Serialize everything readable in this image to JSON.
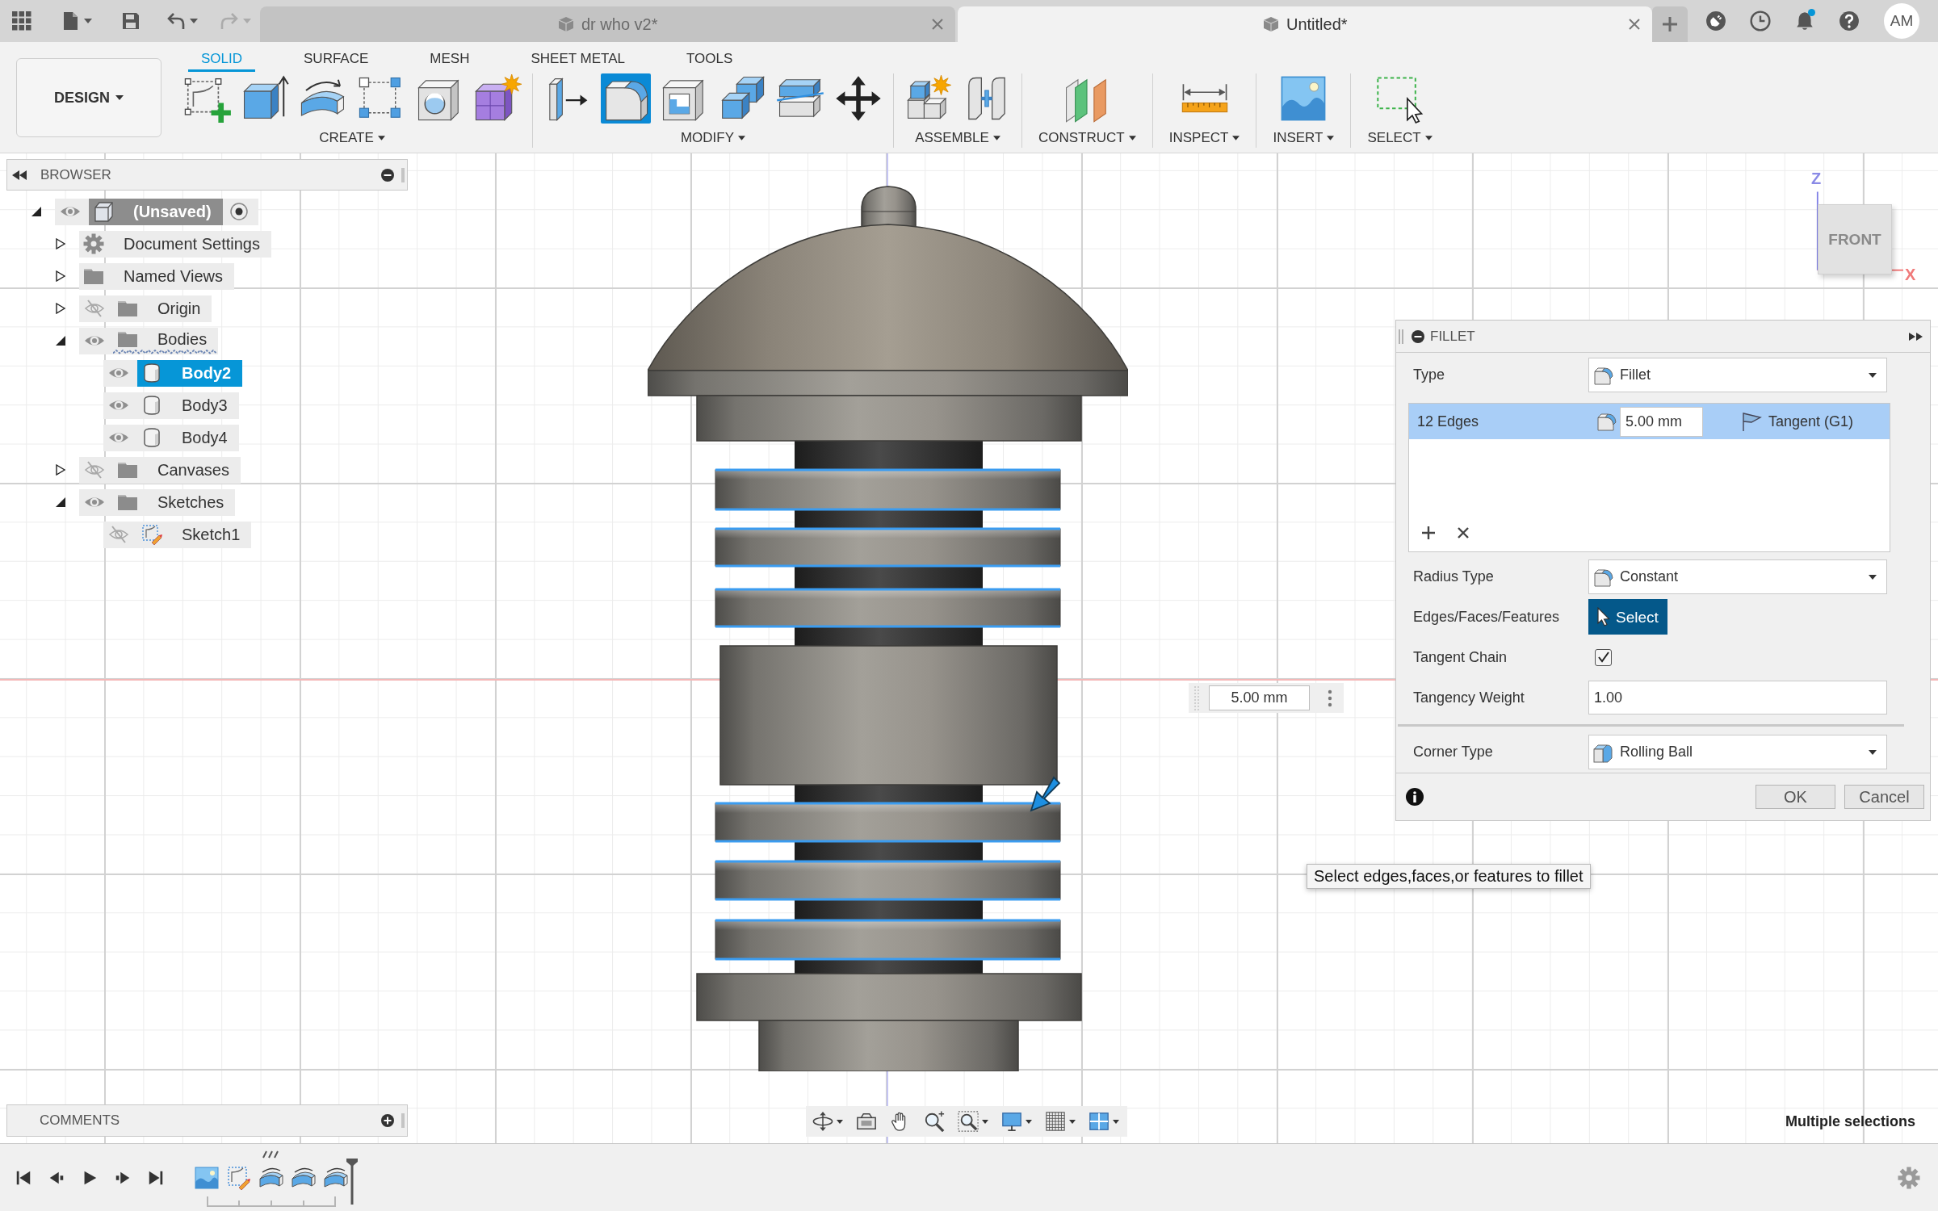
{
  "title_bar": {
    "quick_access": [
      {
        "kind": "apps",
        "disabled": false
      },
      {
        "kind": "file",
        "disabled": false
      },
      {
        "kind": "save",
        "disabled": false
      },
      {
        "kind": "undo",
        "disabled": false
      },
      {
        "kind": "redo",
        "disabled": true
      }
    ],
    "tabs": [
      {
        "title": "dr who v2*",
        "selected": false
      },
      {
        "title": "Untitled*",
        "selected": true
      }
    ],
    "notifications_unread": true,
    "avatar": "AM"
  },
  "toolbar": {
    "workspace": "DESIGN",
    "tabs": [
      {
        "label": "SOLID",
        "selected": true
      },
      {
        "label": "SURFACE",
        "selected": false
      },
      {
        "label": "MESH",
        "selected": false
      },
      {
        "label": "SHEET METAL",
        "selected": false
      },
      {
        "label": "TOOLS",
        "selected": false
      }
    ],
    "groups": [
      {
        "label": "CREATE",
        "tools": [
          {
            "kind": "sketch",
            "selected": false
          },
          {
            "kind": "extrude",
            "selected": false
          },
          {
            "kind": "revolve",
            "selected": false
          },
          {
            "kind": "pattern",
            "selected": false
          },
          {
            "kind": "hole",
            "selected": false
          },
          {
            "kind": "form",
            "selected": false
          }
        ]
      },
      {
        "label": "MODIFY",
        "tools": [
          {
            "kind": "press_pull",
            "selected": false
          },
          {
            "kind": "fillet",
            "selected": true
          },
          {
            "kind": "shell",
            "selected": false
          },
          {
            "kind": "combine",
            "selected": false
          },
          {
            "kind": "split",
            "selected": false
          },
          {
            "kind": "move",
            "selected": false
          }
        ]
      },
      {
        "label": "ASSEMBLE",
        "tools": [
          {
            "kind": "component",
            "selected": false
          },
          {
            "kind": "joint",
            "selected": false
          }
        ]
      },
      {
        "label": "CONSTRUCT",
        "tools": [
          {
            "kind": "plane",
            "selected": false
          }
        ]
      },
      {
        "label": "INSPECT",
        "tools": [
          {
            "kind": "measure",
            "selected": false
          }
        ]
      },
      {
        "label": "INSERT",
        "tools": [
          {
            "kind": "image",
            "selected": false
          }
        ]
      },
      {
        "label": "SELECT",
        "tools": [
          {
            "kind": "window_select",
            "selected": false
          }
        ]
      }
    ]
  },
  "browser": {
    "title": "BROWSER",
    "tree": [
      {
        "label": "(Unsaved)",
        "kind": "component",
        "visible": true,
        "expanded": true,
        "active": true,
        "selected": false,
        "marked": false,
        "children": [
          {
            "label": "Document Settings",
            "kind": "settings",
            "expanded": false,
            "selected": false,
            "marked": false
          },
          {
            "label": "Named Views",
            "kind": "folder",
            "expanded": false,
            "selected": false,
            "marked": false
          },
          {
            "label": "Origin",
            "kind": "folder",
            "visible": false,
            "expanded": false,
            "selected": false,
            "marked": false
          },
          {
            "label": "Bodies",
            "kind": "folder",
            "visible": true,
            "expanded": true,
            "selected": false,
            "marked": true,
            "children": [
              {
                "label": "Body2",
                "kind": "body",
                "visible": true,
                "selected": true,
                "marked": false
              },
              {
                "label": "Body3",
                "kind": "body",
                "visible": true,
                "selected": false,
                "marked": false
              },
              {
                "label": "Body4",
                "kind": "body",
                "visible": true,
                "selected": false,
                "marked": false
              }
            ]
          },
          {
            "label": "Canvases",
            "kind": "folder",
            "visible": false,
            "expanded": false,
            "selected": false,
            "marked": false
          },
          {
            "label": "Sketches",
            "kind": "folder",
            "visible": true,
            "expanded": true,
            "selected": false,
            "marked": false,
            "children": [
              {
                "label": "Sketch1",
                "kind": "sketch",
                "visible": false,
                "selected": false,
                "marked": false
              }
            ]
          }
        ]
      }
    ]
  },
  "viewport": {
    "view_cube": {
      "face": "FRONT",
      "axis_vertical": "Z",
      "axis_horizontal": "X"
    },
    "dimension_input": {
      "value": "5.00 mm"
    },
    "tooltip": "Select edges,faces,or features to fillet",
    "status": "Multiple selections"
  },
  "fillet_panel": {
    "title": "FILLET",
    "type": {
      "label": "Type",
      "value": "Fillet"
    },
    "edge_sets": [
      {
        "label": "12 Edges",
        "radius": "5.00 mm",
        "continuity": "Tangent (G1)",
        "selected": true
      }
    ],
    "radius_type": {
      "label": "Radius Type",
      "value": "Constant"
    },
    "selection": {
      "label": "Edges/Faces/Features",
      "button": "Select",
      "active": true
    },
    "tangent_chain": {
      "label": "Tangent Chain",
      "checked": true
    },
    "tangency_weight": {
      "label": "Tangency Weight",
      "value": "1.00"
    },
    "corner_type": {
      "label": "Corner Type",
      "value": "Rolling Ball"
    },
    "buttons": [
      "OK",
      "Cancel"
    ]
  },
  "comments": {
    "title": "COMMENTS"
  },
  "timeline": {
    "features": [
      {
        "kind": "canvas",
        "marked": false
      },
      {
        "kind": "sketch",
        "marked": false
      },
      {
        "kind": "revolve",
        "marked": true
      },
      {
        "kind": "revolve",
        "marked": false
      },
      {
        "kind": "revolve",
        "marked": false
      }
    ]
  }
}
